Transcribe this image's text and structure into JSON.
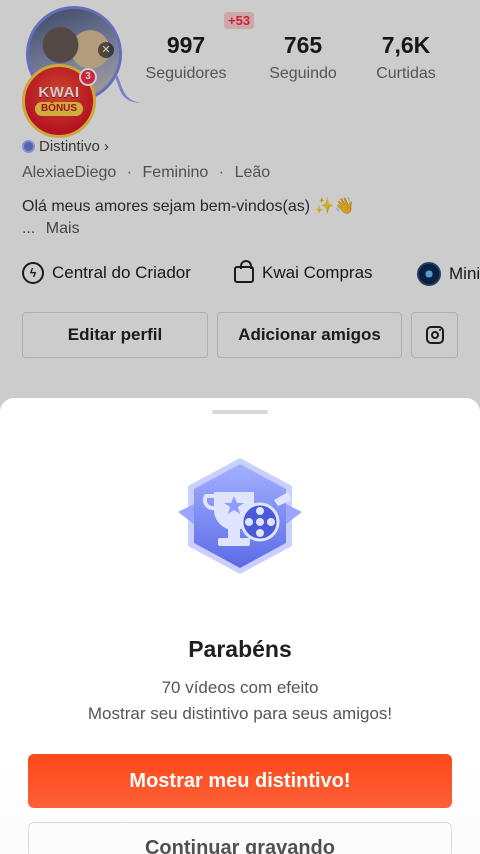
{
  "profile": {
    "kwai_bonus": {
      "line1": "KWAI",
      "line2": "BÔNUS",
      "badge_count": "3"
    },
    "new_followers_badge": "+53",
    "stats": [
      {
        "value": "997",
        "label": "Seguidores"
      },
      {
        "value": "765",
        "label": "Seguindo"
      },
      {
        "value": "7,6K",
        "label": "Curtidas"
      }
    ],
    "distintivo_label": "Distintivo",
    "distintivo_chevron": "›",
    "username": "AlexiaeDiego",
    "gender": "Feminino",
    "sign": "Leão",
    "separator": "·",
    "bio": "Olá meus amores sejam bem-vindos(as) ✨👋",
    "bio_ellipsis": "...",
    "bio_more": "Mais",
    "quick_links": [
      {
        "label": "Central do Criador",
        "icon": "bolt-circle-icon"
      },
      {
        "label": "Kwai Compras",
        "icon": "shopping-bag-icon"
      },
      {
        "label": "Mini",
        "icon": "planet-icon"
      }
    ],
    "edit_profile_label": "Editar perfil",
    "add_friends_label": "Adicionar amigos"
  },
  "sheet": {
    "title": "Parabéns",
    "line1": "70 vídeos com efeito",
    "line2": "Mostrar seu distintivo para seus amigos!",
    "primary_label": "Mostrar meu distintivo!",
    "secondary_label": "Continuar gravando"
  },
  "colors": {
    "accent": "#fe4a1b",
    "badge": "#6b78e5",
    "overlay": "rgba(0,0,0,0.20)"
  }
}
